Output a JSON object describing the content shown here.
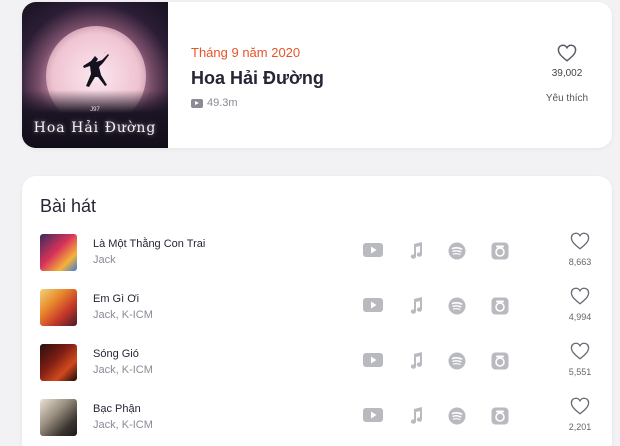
{
  "album": {
    "release_date": "Tháng 9 năm 2020",
    "title": "Hoa Hải Đường",
    "views": "49.3m",
    "like_count": "39,002",
    "like_label": "Yêu thích",
    "cover_text": "Hoa Hải Đường",
    "cover_tag": "J97"
  },
  "songs_section": {
    "title": "Bài hát",
    "songs": [
      {
        "name": "Là Một Thằng Con Trai",
        "artist": "Jack",
        "likes": "8,663"
      },
      {
        "name": "Em Gì Ơi",
        "artist": "Jack, K-ICM",
        "likes": "4,994"
      },
      {
        "name": "Sóng Gió",
        "artist": "Jack, K-ICM",
        "likes": "5,551"
      },
      {
        "name": "Bạc Phận",
        "artist": "Jack, K-ICM",
        "likes": "2,201"
      }
    ]
  },
  "colors": {
    "accent": "#e8542a",
    "icon_gray": "#b9b9c0",
    "background": "#f2f2f4"
  },
  "icons": {
    "like": "heart-icon",
    "platforms": [
      "youtube-icon",
      "apple-music-icon",
      "spotify-icon",
      "other-platform-icon"
    ]
  }
}
